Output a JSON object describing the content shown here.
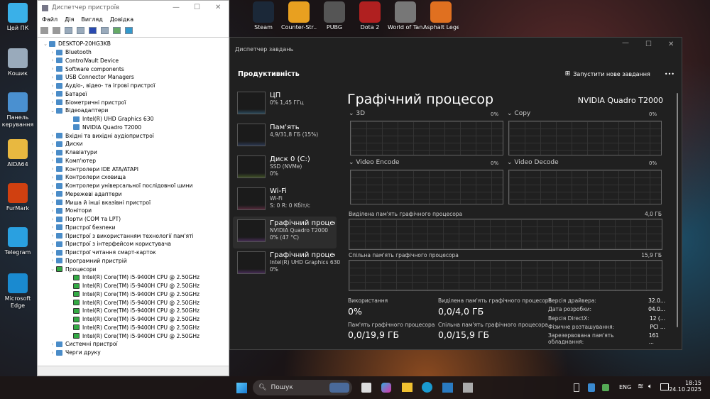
{
  "desktop": {
    "left_icons": [
      {
        "label": "Цей ПК",
        "icon": "monitor-icon",
        "color": "#3ab0e8"
      },
      {
        "label": "Кошик",
        "icon": "recycle-bin-icon",
        "color": "#9ab"
      },
      {
        "label": "Панель керування",
        "icon": "control-panel-icon",
        "color": "#4a90d0"
      },
      {
        "label": "AIDA64",
        "icon": "folder-icon",
        "color": "#e8b840"
      },
      {
        "label": "FurMark",
        "icon": "furmark-icon",
        "color": "#d04010"
      },
      {
        "label": "Telegram",
        "icon": "telegram-icon",
        "color": "#2aa0e0"
      },
      {
        "label": "Microsoft Edge",
        "icon": "edge-icon",
        "color": "#1a8ad0"
      }
    ],
    "top_icons": [
      {
        "label": "Steam",
        "icon": "steam-icon",
        "color": "#1b2838"
      },
      {
        "label": "Counter-Str...",
        "icon": "counter-strike-icon",
        "color": "#e8a020"
      },
      {
        "label": "PUBG",
        "icon": "pubg-icon",
        "color": "#555"
      },
      {
        "label": "Dota 2",
        "icon": "dota2-icon",
        "color": "#b02020"
      },
      {
        "label": "World of Tanks",
        "icon": "world-of-tanks-icon",
        "color": "#777"
      },
      {
        "label": "Asphalt Legends",
        "icon": "asphalt-icon",
        "color": "#e07020"
      }
    ]
  },
  "device_manager": {
    "title": "Диспетчер пристроїв",
    "menu": [
      "Файл",
      "Дія",
      "Вигляд",
      "Довідка"
    ],
    "tree": [
      {
        "label": "DESKTOP-20HG3KB",
        "level": 0,
        "exp": "v"
      },
      {
        "label": "Bluetooth",
        "level": 1,
        "exp": ">"
      },
      {
        "label": "ControlVault Device",
        "level": 1,
        "exp": ">"
      },
      {
        "label": "Software components",
        "level": 1,
        "exp": ">"
      },
      {
        "label": "USB Connector Managers",
        "level": 1,
        "exp": ">"
      },
      {
        "label": "Аудіо-, відео- та ігрові пристрої",
        "level": 1,
        "exp": ">"
      },
      {
        "label": "Батареї",
        "level": 1,
        "exp": ">"
      },
      {
        "label": "Біометричні пристрої",
        "level": 1,
        "exp": ">"
      },
      {
        "label": "Відеоадаптери",
        "level": 1,
        "exp": "v"
      },
      {
        "label": "Intel(R) UHD Graphics 630",
        "level": 2,
        "exp": ""
      },
      {
        "label": "NVIDIA Quadro T2000",
        "level": 2,
        "exp": ""
      },
      {
        "label": "Вхідні та вихідні аудіопристрої",
        "level": 1,
        "exp": ">"
      },
      {
        "label": "Диски",
        "level": 1,
        "exp": ">"
      },
      {
        "label": "Клавіатури",
        "level": 1,
        "exp": ">"
      },
      {
        "label": "Комп'ютер",
        "level": 1,
        "exp": ">"
      },
      {
        "label": "Контролери IDE ATA/ATAPI",
        "level": 1,
        "exp": ">"
      },
      {
        "label": "Контролери сховища",
        "level": 1,
        "exp": ">"
      },
      {
        "label": "Контролери універсальної послідовної шини",
        "level": 1,
        "exp": ">"
      },
      {
        "label": "Мережеві адаптери",
        "level": 1,
        "exp": ">"
      },
      {
        "label": "Миша й інші вказівні пристрої",
        "level": 1,
        "exp": ">"
      },
      {
        "label": "Монітори",
        "level": 1,
        "exp": ">"
      },
      {
        "label": "Порти (COM та LPT)",
        "level": 1,
        "exp": ">"
      },
      {
        "label": "Пристрої безпеки",
        "level": 1,
        "exp": ">"
      },
      {
        "label": "Пристрої з використанням технології пам'яті",
        "level": 1,
        "exp": ">"
      },
      {
        "label": "Пристрої з інтерфейсом користувача",
        "level": 1,
        "exp": ">"
      },
      {
        "label": "Пристрої читання смарт-карток",
        "level": 1,
        "exp": ">"
      },
      {
        "label": "Програмний пристрій",
        "level": 1,
        "exp": ">"
      },
      {
        "label": "Процесори",
        "level": 1,
        "exp": "v"
      },
      {
        "label": "Intel(R) Core(TM) i5-9400H CPU @ 2.50GHz",
        "level": 2,
        "exp": "",
        "cpu": true
      },
      {
        "label": "Intel(R) Core(TM) i5-9400H CPU @ 2.50GHz",
        "level": 2,
        "exp": "",
        "cpu": true
      },
      {
        "label": "Intel(R) Core(TM) i5-9400H CPU @ 2.50GHz",
        "level": 2,
        "exp": "",
        "cpu": true
      },
      {
        "label": "Intel(R) Core(TM) i5-9400H CPU @ 2.50GHz",
        "level": 2,
        "exp": "",
        "cpu": true
      },
      {
        "label": "Intel(R) Core(TM) i5-9400H CPU @ 2.50GHz",
        "level": 2,
        "exp": "",
        "cpu": true
      },
      {
        "label": "Intel(R) Core(TM) i5-9400H CPU @ 2.50GHz",
        "level": 2,
        "exp": "",
        "cpu": true
      },
      {
        "label": "Intel(R) Core(TM) i5-9400H CPU @ 2.50GHz",
        "level": 2,
        "exp": "",
        "cpu": true
      },
      {
        "label": "Intel(R) Core(TM) i5-9400H CPU @ 2.50GHz",
        "level": 2,
        "exp": "",
        "cpu": true
      },
      {
        "label": "Системні пристрої",
        "level": 1,
        "exp": ">"
      },
      {
        "label": "Черги друку",
        "level": 1,
        "exp": ">"
      }
    ]
  },
  "task_manager": {
    "title": "Диспетчер завдань",
    "section": "Продуктивність",
    "run_task": "Запустити нове завдання",
    "more": "•••",
    "sidebar": [
      {
        "name": "ЦП",
        "l1": "0% 1,45 ГГц",
        "l2": "",
        "color": "#4aa8e0"
      },
      {
        "name": "Пам'ять",
        "l1": "4,9/31,8 ГБ (15%)",
        "l2": "",
        "color": "#4a70c0"
      },
      {
        "name": "Диск 0 (C:)",
        "l1": "SSD (NVMe)",
        "l2": "0%",
        "color": "#8ac040"
      },
      {
        "name": "Wi-Fi",
        "l1": "Wi-Fi",
        "l2": "S: 0 R: 0 Кбіт/с",
        "color": "#d04a80"
      },
      {
        "name": "Графічний процесор",
        "l1": "NVIDIA Quadro T2000",
        "l2": "0% (47 °C)",
        "color": "#a050d0"
      },
      {
        "name": "Графічний процесор",
        "l1": "Intel(R) UHD Graphics 630",
        "l2": "0%",
        "color": "#a050d0"
      }
    ],
    "main": {
      "title": "Графічний процесор",
      "gpu_name": "NVIDIA Quadro T2000",
      "engines": [
        {
          "name": "3D",
          "pct": "0%"
        },
        {
          "name": "Copy",
          "pct": "0%"
        },
        {
          "name": "Video Encode",
          "pct": "0%"
        },
        {
          "name": "Video Decode",
          "pct": "0%"
        }
      ],
      "dedicated_label": "Виділена пам'ять графічного процесора",
      "dedicated_max": "4,0 ГБ",
      "shared_label": "Спільна пам'ять графічного процесора",
      "shared_max": "15,9 ГБ",
      "stats": {
        "usage_label": "Використання",
        "usage": "0%",
        "gpu_mem_label": "Пам'ять графічного процесора",
        "gpu_mem": "0,0/19,9 ГБ",
        "ded_label": "Виділена пам'ять графічного процесора",
        "ded": "0,0/4,0 ГБ",
        "sh_label": "Спільна пам'ять графічного процесора",
        "sh": "0,0/15,9 ГБ"
      },
      "info": [
        {
          "k": "Версія драйвера:",
          "v": "32.0..."
        },
        {
          "k": "Дата розробки:",
          "v": "04.0..."
        },
        {
          "k": "Версія DirectX:",
          "v": "12 (..."
        },
        {
          "k": "Фізичне розташування:",
          "v": "PCI ..."
        },
        {
          "k": "Зарезервована пам'ять обладнання:",
          "v": "161 ..."
        }
      ]
    }
  },
  "taskbar": {
    "search": "Пошук",
    "lang": "ENG",
    "time": "18:15",
    "date": "24.10.2025"
  }
}
